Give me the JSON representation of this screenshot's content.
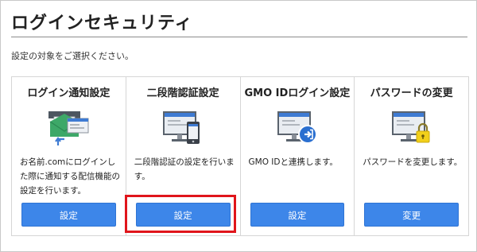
{
  "page": {
    "title": "ログインセキュリティ",
    "instruction": "設定の対象をご選択ください。"
  },
  "cards": [
    {
      "title": "ログイン通知設定",
      "icon": "mail-notification-icon",
      "description": "お名前.comにログインした際に通知する配信機能の設定を行います。",
      "button_label": "設定"
    },
    {
      "title": "二段階認証設定",
      "icon": "monitor-phone-icon",
      "description": "二段階認証の設定を行います。",
      "button_label": "設定"
    },
    {
      "title": "GMO IDログイン設定",
      "icon": "monitor-login-icon",
      "description": "GMO IDと連携します。",
      "button_label": "設定"
    },
    {
      "title": "パスワードの変更",
      "icon": "monitor-lock-icon",
      "description": "パスワードを変更します。",
      "button_label": "変更"
    }
  ],
  "colors": {
    "button": "#3d86e9",
    "highlight": "#e0151b",
    "accent_green": "#3da868",
    "lock_yellow": "#f2d01a"
  }
}
